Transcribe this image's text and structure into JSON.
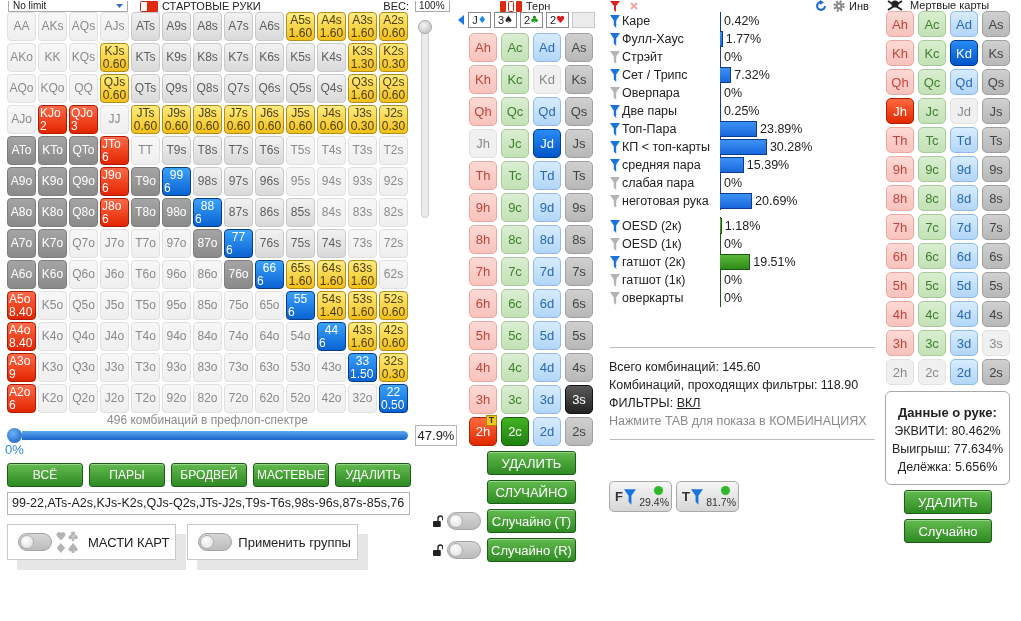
{
  "top_bar": {
    "game_type": "No limit",
    "section_title": "СТАРТОВЫЕ РУКИ",
    "weight_label": "ВЕС:",
    "weight_value": "100%"
  },
  "hand_grid": {
    "rows": [
      [
        {
          "label": "AA",
          "kind": "blocked"
        },
        {
          "label": "AKs",
          "kind": "blocked"
        },
        {
          "label": "AQs",
          "kind": "blocked"
        },
        {
          "label": "AJs",
          "kind": "blocked"
        },
        {
          "label": "ATs",
          "kind": "empty"
        },
        {
          "label": "A9s",
          "kind": "empty"
        },
        {
          "label": "A8s",
          "kind": "empty"
        },
        {
          "label": "A7s",
          "kind": "empty"
        },
        {
          "label": "A6s",
          "kind": "empty"
        },
        {
          "label": "A5s",
          "kind": "yellow",
          "weight": "1.60"
        },
        {
          "label": "A4s",
          "kind": "yellow",
          "weight": "1.60"
        },
        {
          "label": "A3s",
          "kind": "yellow",
          "weight": "1.60"
        },
        {
          "label": "A2s",
          "kind": "yellow",
          "weight": "0.60"
        }
      ],
      [
        {
          "label": "AKo",
          "kind": "blocked"
        },
        {
          "label": "KK",
          "kind": "blocked"
        },
        {
          "label": "KQs",
          "kind": "blocked"
        },
        {
          "label": "KJs",
          "kind": "yellow",
          "weight": "0.60"
        },
        {
          "label": "KTs",
          "kind": "empty"
        },
        {
          "label": "K9s",
          "kind": "empty"
        },
        {
          "label": "K8s",
          "kind": "empty"
        },
        {
          "label": "K7s",
          "kind": "empty"
        },
        {
          "label": "K6s",
          "kind": "empty"
        },
        {
          "label": "K5s",
          "kind": "empty"
        },
        {
          "label": "K4s",
          "kind": "empty"
        },
        {
          "label": "K3s",
          "kind": "yellow",
          "weight": "1.30"
        },
        {
          "label": "K2s",
          "kind": "yellow",
          "weight": "0.30"
        }
      ],
      [
        {
          "label": "AQo",
          "kind": "blocked"
        },
        {
          "label": "KQo",
          "kind": "blocked"
        },
        {
          "label": "QQ",
          "kind": "blocked"
        },
        {
          "label": "QJs",
          "kind": "yellow",
          "weight": "0.60"
        },
        {
          "label": "QTs",
          "kind": "empty"
        },
        {
          "label": "Q9s",
          "kind": "empty"
        },
        {
          "label": "Q8s",
          "kind": "empty"
        },
        {
          "label": "Q7s",
          "kind": "empty"
        },
        {
          "label": "Q6s",
          "kind": "empty"
        },
        {
          "label": "Q5s",
          "kind": "empty"
        },
        {
          "label": "Q4s",
          "kind": "empty"
        },
        {
          "label": "Q3s",
          "kind": "yellow",
          "weight": "1.60"
        },
        {
          "label": "Q2s",
          "kind": "yellow",
          "weight": "0.60"
        }
      ],
      [
        {
          "label": "AJo",
          "kind": "blocked"
        },
        {
          "label": "KJo",
          "kind": "red",
          "weight": "2"
        },
        {
          "label": "QJo",
          "kind": "red",
          "weight": "3"
        },
        {
          "label": "JJ",
          "kind": "blocked"
        },
        {
          "label": "JTs",
          "kind": "yellow",
          "weight": "0.60"
        },
        {
          "label": "J9s",
          "kind": "yellow",
          "weight": "0.60"
        },
        {
          "label": "J8s",
          "kind": "yellow",
          "weight": "0.60"
        },
        {
          "label": "J7s",
          "kind": "yellow",
          "weight": "0.60"
        },
        {
          "label": "J6s",
          "kind": "yellow",
          "weight": "0.60"
        },
        {
          "label": "J5s",
          "kind": "yellow",
          "weight": "0.60"
        },
        {
          "label": "J4s",
          "kind": "yellow",
          "weight": "0.60"
        },
        {
          "label": "J3s",
          "kind": "yellow",
          "weight": "0.30"
        },
        {
          "label": "J2s",
          "kind": "yellow",
          "weight": "0.30"
        }
      ],
      [
        {
          "label": "ATo",
          "kind": "gray"
        },
        {
          "label": "KTo",
          "kind": "gray"
        },
        {
          "label": "QTo",
          "kind": "gray"
        },
        {
          "label": "JTo",
          "kind": "red",
          "weight": "6"
        },
        {
          "label": "TT",
          "kind": "blocked"
        },
        {
          "label": "T9s",
          "kind": "empty"
        },
        {
          "label": "T8s",
          "kind": "empty"
        },
        {
          "label": "T7s",
          "kind": "empty"
        },
        {
          "label": "T6s",
          "kind": "empty"
        },
        {
          "label": "T5s",
          "kind": "blocked"
        },
        {
          "label": "T4s",
          "kind": "blocked"
        },
        {
          "label": "T3s",
          "kind": "blocked"
        },
        {
          "label": "T2s",
          "kind": "blocked"
        }
      ],
      [
        {
          "label": "A9o",
          "kind": "gray"
        },
        {
          "label": "K9o",
          "kind": "gray"
        },
        {
          "label": "Q9o",
          "kind": "gray"
        },
        {
          "label": "J9o",
          "kind": "red",
          "weight": "6"
        },
        {
          "label": "T9o",
          "kind": "gray"
        },
        {
          "label": "99",
          "kind": "blue",
          "weight": "6"
        },
        {
          "label": "98s",
          "kind": "empty"
        },
        {
          "label": "97s",
          "kind": "empty"
        },
        {
          "label": "96s",
          "kind": "empty"
        },
        {
          "label": "95s",
          "kind": "blocked"
        },
        {
          "label": "94s",
          "kind": "blocked"
        },
        {
          "label": "93s",
          "kind": "blocked"
        },
        {
          "label": "92s",
          "kind": "blocked"
        }
      ],
      [
        {
          "label": "A8o",
          "kind": "gray"
        },
        {
          "label": "K8o",
          "kind": "gray"
        },
        {
          "label": "Q8o",
          "kind": "gray"
        },
        {
          "label": "J8o",
          "kind": "red",
          "weight": "6"
        },
        {
          "label": "T8o",
          "kind": "gray"
        },
        {
          "label": "98o",
          "kind": "gray"
        },
        {
          "label": "88",
          "kind": "blue",
          "weight": "6"
        },
        {
          "label": "87s",
          "kind": "empty"
        },
        {
          "label": "86s",
          "kind": "empty"
        },
        {
          "label": "85s",
          "kind": "empty"
        },
        {
          "label": "84s",
          "kind": "blocked"
        },
        {
          "label": "83s",
          "kind": "blocked"
        },
        {
          "label": "82s",
          "kind": "blocked"
        }
      ],
      [
        {
          "label": "A7o",
          "kind": "gray"
        },
        {
          "label": "K7o",
          "kind": "gray"
        },
        {
          "label": "Q7o",
          "kind": "blocked"
        },
        {
          "label": "J7o",
          "kind": "blocked"
        },
        {
          "label": "T7o",
          "kind": "blocked"
        },
        {
          "label": "97o",
          "kind": "blocked"
        },
        {
          "label": "87o",
          "kind": "gray"
        },
        {
          "label": "77",
          "kind": "blue",
          "weight": "6"
        },
        {
          "label": "76s",
          "kind": "empty"
        },
        {
          "label": "75s",
          "kind": "empty"
        },
        {
          "label": "74s",
          "kind": "empty"
        },
        {
          "label": "73s",
          "kind": "blocked"
        },
        {
          "label": "72s",
          "kind": "blocked"
        }
      ],
      [
        {
          "label": "A6o",
          "kind": "gray"
        },
        {
          "label": "K6o",
          "kind": "gray"
        },
        {
          "label": "Q6o",
          "kind": "blocked"
        },
        {
          "label": "J6o",
          "kind": "blocked"
        },
        {
          "label": "T6o",
          "kind": "blocked"
        },
        {
          "label": "96o",
          "kind": "blocked"
        },
        {
          "label": "86o",
          "kind": "blocked"
        },
        {
          "label": "76o",
          "kind": "gray"
        },
        {
          "label": "66",
          "kind": "blue",
          "weight": "6"
        },
        {
          "label": "65s",
          "kind": "yellow",
          "weight": "1.60"
        },
        {
          "label": "64s",
          "kind": "yellow",
          "weight": "1.60"
        },
        {
          "label": "63s",
          "kind": "yellow",
          "weight": "1.60"
        },
        {
          "label": "62s",
          "kind": "blocked"
        }
      ],
      [
        {
          "label": "A5o",
          "kind": "red",
          "weight": "8.40"
        },
        {
          "label": "K5o",
          "kind": "blocked"
        },
        {
          "label": "Q5o",
          "kind": "blocked"
        },
        {
          "label": "J5o",
          "kind": "blocked"
        },
        {
          "label": "T5o",
          "kind": "blocked"
        },
        {
          "label": "95o",
          "kind": "blocked"
        },
        {
          "label": "85o",
          "kind": "blocked"
        },
        {
          "label": "75o",
          "kind": "blocked"
        },
        {
          "label": "65o",
          "kind": "blocked"
        },
        {
          "label": "55",
          "kind": "blue",
          "weight": "6"
        },
        {
          "label": "54s",
          "kind": "yellow",
          "weight": "1.40"
        },
        {
          "label": "53s",
          "kind": "yellow",
          "weight": "1.60"
        },
        {
          "label": "52s",
          "kind": "yellow",
          "weight": "0.60"
        }
      ],
      [
        {
          "label": "A4o",
          "kind": "red",
          "weight": "8.40"
        },
        {
          "label": "K4o",
          "kind": "blocked"
        },
        {
          "label": "Q4o",
          "kind": "blocked"
        },
        {
          "label": "J4o",
          "kind": "blocked"
        },
        {
          "label": "T4o",
          "kind": "blocked"
        },
        {
          "label": "94o",
          "kind": "blocked"
        },
        {
          "label": "84o",
          "kind": "blocked"
        },
        {
          "label": "74o",
          "kind": "blocked"
        },
        {
          "label": "64o",
          "kind": "blocked"
        },
        {
          "label": "54o",
          "kind": "blocked"
        },
        {
          "label": "44",
          "kind": "blue",
          "weight": "6"
        },
        {
          "label": "43s",
          "kind": "yellow",
          "weight": "1.60"
        },
        {
          "label": "42s",
          "kind": "yellow",
          "weight": "0.60"
        }
      ],
      [
        {
          "label": "A3o",
          "kind": "red",
          "weight": "9"
        },
        {
          "label": "K3o",
          "kind": "blocked"
        },
        {
          "label": "Q3o",
          "kind": "blocked"
        },
        {
          "label": "J3o",
          "kind": "blocked"
        },
        {
          "label": "T3o",
          "kind": "blocked"
        },
        {
          "label": "93o",
          "kind": "blocked"
        },
        {
          "label": "83o",
          "kind": "blocked"
        },
        {
          "label": "73o",
          "kind": "blocked"
        },
        {
          "label": "63o",
          "kind": "blocked"
        },
        {
          "label": "53o",
          "kind": "blocked"
        },
        {
          "label": "43o",
          "kind": "blocked"
        },
        {
          "label": "33",
          "kind": "blue",
          "weight": "1.50"
        },
        {
          "label": "32s",
          "kind": "yellow",
          "weight": "0.30"
        }
      ],
      [
        {
          "label": "A2o",
          "kind": "red",
          "weight": "6"
        },
        {
          "label": "K2o",
          "kind": "blocked"
        },
        {
          "label": "Q2o",
          "kind": "blocked"
        },
        {
          "label": "J2o",
          "kind": "blocked"
        },
        {
          "label": "T2o",
          "kind": "blocked"
        },
        {
          "label": "92o",
          "kind": "blocked"
        },
        {
          "label": "82o",
          "kind": "blocked"
        },
        {
          "label": "72o",
          "kind": "blocked"
        },
        {
          "label": "62o",
          "kind": "blocked"
        },
        {
          "label": "52o",
          "kind": "blocked"
        },
        {
          "label": "42o",
          "kind": "blocked"
        },
        {
          "label": "32o",
          "kind": "blocked"
        },
        {
          "label": "22",
          "kind": "blue",
          "weight": "0.50"
        }
      ]
    ]
  },
  "weight_slider": {
    "level": 1
  },
  "range_slider": {
    "caption": "496 комбинаций в префлоп-спектре",
    "level": 0,
    "min_label": "0%",
    "value": "47.9%"
  },
  "range_buttons": [
    "ВСЁ",
    "ПАРЫ",
    "БРОДВЕЙ",
    "МАСТЕВЫЕ",
    "УДАЛИТЬ"
  ],
  "range_text": "99-22,ATs-A2s,KJs-K2s,QJs-Q2s,JTs-J2s,T9s-T6s,98s-96s,87s-85s,76",
  "option_panels": [
    {
      "kind": "suits",
      "label": "МАСТИ КАРТ",
      "on": false
    },
    {
      "kind": "plain",
      "label": "Применить группы",
      "on": false
    }
  ],
  "board": {
    "title": "Терн",
    "cards": [
      {
        "kind": "card",
        "rank": "J",
        "suit": "♦",
        "color": "#1a8cf0"
      },
      {
        "kind": "card",
        "rank": "3",
        "suit": "♠",
        "color": "#222222"
      },
      {
        "kind": "card",
        "rank": "2",
        "suit": "♣",
        "color": "#1e9a1e"
      },
      {
        "kind": "card",
        "rank": "2",
        "suit": "♥",
        "color": "#e01818"
      },
      {
        "kind": "empty"
      }
    ]
  },
  "board_deck": {
    "columns": [
      {
        "kind": "hearts",
        "cards": [
          {
            "label": "Ah",
            "selected": false,
            "disabled": false
          },
          {
            "label": "Kh",
            "selected": false,
            "disabled": false
          },
          {
            "label": "Qh",
            "selected": false,
            "disabled": false
          },
          {
            "label": "Jh",
            "selected": false,
            "disabled": true
          },
          {
            "label": "Th",
            "selected": false,
            "disabled": false
          },
          {
            "label": "9h",
            "selected": false,
            "disabled": false
          },
          {
            "label": "8h",
            "selected": false,
            "disabled": false
          },
          {
            "label": "7h",
            "selected": false,
            "disabled": false
          },
          {
            "label": "6h",
            "selected": false,
            "disabled": false
          },
          {
            "label": "5h",
            "selected": false,
            "disabled": false
          },
          {
            "label": "4h",
            "selected": false,
            "disabled": false
          },
          {
            "label": "3h",
            "selected": false,
            "disabled": false
          },
          {
            "label": "2h",
            "selected": true,
            "disabled": false,
            "badge": "T"
          }
        ]
      },
      {
        "kind": "clubs",
        "cards": [
          {
            "label": "Ac",
            "selected": false,
            "disabled": false
          },
          {
            "label": "Kc",
            "selected": false,
            "disabled": false
          },
          {
            "label": "Qc",
            "selected": false,
            "disabled": false
          },
          {
            "label": "Jc",
            "selected": false,
            "disabled": false
          },
          {
            "label": "Tc",
            "selected": false,
            "disabled": false
          },
          {
            "label": "9c",
            "selected": false,
            "disabled": false
          },
          {
            "label": "8c",
            "selected": false,
            "disabled": false
          },
          {
            "label": "7c",
            "selected": false,
            "disabled": false
          },
          {
            "label": "6c",
            "selected": false,
            "disabled": false
          },
          {
            "label": "5c",
            "selected": false,
            "disabled": false
          },
          {
            "label": "4c",
            "selected": false,
            "disabled": false
          },
          {
            "label": "3c",
            "selected": false,
            "disabled": false
          },
          {
            "label": "2c",
            "selected": true,
            "disabled": false
          }
        ]
      },
      {
        "kind": "diamonds",
        "cards": [
          {
            "label": "Ad",
            "selected": false,
            "disabled": false
          },
          {
            "label": "Kd",
            "selected": false,
            "disabled": true
          },
          {
            "label": "Qd",
            "selected": false,
            "disabled": false
          },
          {
            "label": "Jd",
            "selected": true,
            "disabled": false
          },
          {
            "label": "Td",
            "selected": false,
            "disabled": false
          },
          {
            "label": "9d",
            "selected": false,
            "disabled": false
          },
          {
            "label": "8d",
            "selected": false,
            "disabled": false
          },
          {
            "label": "7d",
            "selected": false,
            "disabled": false
          },
          {
            "label": "6d",
            "selected": false,
            "disabled": false
          },
          {
            "label": "5d",
            "selected": false,
            "disabled": false
          },
          {
            "label": "4d",
            "selected": false,
            "disabled": false
          },
          {
            "label": "3d",
            "selected": false,
            "disabled": false
          },
          {
            "label": "2d",
            "selected": false,
            "disabled": false
          }
        ]
      },
      {
        "kind": "spades",
        "cards": [
          {
            "label": "As",
            "selected": false,
            "disabled": false
          },
          {
            "label": "Ks",
            "selected": false,
            "disabled": false
          },
          {
            "label": "Qs",
            "selected": false,
            "disabled": false
          },
          {
            "label": "Js",
            "selected": false,
            "disabled": false
          },
          {
            "label": "Ts",
            "selected": false,
            "disabled": false
          },
          {
            "label": "9s",
            "selected": false,
            "disabled": false
          },
          {
            "label": "8s",
            "selected": false,
            "disabled": false
          },
          {
            "label": "7s",
            "selected": false,
            "disabled": false
          },
          {
            "label": "6s",
            "selected": false,
            "disabled": false
          },
          {
            "label": "5s",
            "selected": false,
            "disabled": false
          },
          {
            "label": "4s",
            "selected": false,
            "disabled": false
          },
          {
            "label": "3s",
            "selected": true,
            "disabled": false
          },
          {
            "label": "2s",
            "selected": false,
            "disabled": false
          }
        ]
      }
    ]
  },
  "deck_buttons": [
    {
      "kind": "plain",
      "label": "УДАЛИТЬ"
    },
    {
      "kind": "plain",
      "label": "СЛУЧАЙНО"
    },
    {
      "kind": "lockable",
      "label": "Случайно (T)",
      "locked": false,
      "on": false
    },
    {
      "kind": "lockable",
      "label": "Случайно (R)",
      "locked": false,
      "on": false
    }
  ],
  "stats_header": {
    "invert_label": "Инв"
  },
  "stat_groups": [
    {
      "kind": "made",
      "rows": [
        {
          "label": "Каре",
          "value": "0.42%",
          "level": 0.0042,
          "filter_on": true
        },
        {
          "label": "Фулл-Хаус",
          "value": "1.77%",
          "level": 0.0177,
          "filter_on": true
        },
        {
          "label": "Стрэйт",
          "value": "0%",
          "level": 0,
          "filter_on": false
        },
        {
          "label": "Сет / Трипс",
          "value": "7.32%",
          "level": 0.0732,
          "filter_on": true
        },
        {
          "label": "Оверпара",
          "value": "0%",
          "level": 0,
          "filter_on": false
        },
        {
          "label": "Две пары",
          "value": "0.25%",
          "level": 0.0025,
          "filter_on": true
        },
        {
          "label": "Топ-Пара",
          "value": "23.89%",
          "level": 0.2389,
          "filter_on": true
        },
        {
          "label": "КП < топ-карты",
          "value": "30.28%",
          "level": 0.3028,
          "filter_on": true
        },
        {
          "label": "средняя пара",
          "value": "15.39%",
          "level": 0.1539,
          "filter_on": true
        },
        {
          "label": "слабая пара",
          "value": "0%",
          "level": 0,
          "filter_on": false
        },
        {
          "label": "неготовая рука",
          "value": "20.69%",
          "level": 0.2069,
          "filter_on": false
        }
      ]
    },
    {
      "kind": "draws",
      "rows": [
        {
          "label": "OESD (2к)",
          "value": "1.18%",
          "level": 0.0118,
          "filter_on": true
        },
        {
          "label": "OESD (1к)",
          "value": "0%",
          "level": 0,
          "filter_on": false
        },
        {
          "label": "гатшот (2к)",
          "value": "19.51%",
          "level": 0.1951,
          "filter_on": true
        },
        {
          "label": "гатшот (1к)",
          "value": "0%",
          "level": 0,
          "filter_on": false
        },
        {
          "label": "оверкарты",
          "value": "0%",
          "level": 0,
          "filter_on": false
        }
      ]
    }
  ],
  "summary": {
    "total": "Всего комбинаций: 145.60",
    "passing": "Комбинаций, проходящих фильтры: 118.90",
    "filters_label": "ФИЛЬТРЫ:",
    "filters_link": "ВКЛ",
    "hint": "Нажмите TAB для показа в КОМБИНАЦИЯХ"
  },
  "filter_badges": [
    {
      "letter": "F",
      "value": "29.4%",
      "on": true
    },
    {
      "letter": "T",
      "value": "81.7%",
      "on": true
    }
  ],
  "dead_cards": {
    "title": "Мертвые карты",
    "columns": [
      {
        "kind": "hearts",
        "cards": [
          {
            "label": "Ah",
            "selected": false,
            "disabled": false
          },
          {
            "label": "Kh",
            "selected": false,
            "disabled": false
          },
          {
            "label": "Qh",
            "selected": false,
            "disabled": false
          },
          {
            "label": "Jh",
            "selected": true,
            "disabled": false
          },
          {
            "label": "Th",
            "selected": false,
            "disabled": false
          },
          {
            "label": "9h",
            "selected": false,
            "disabled": false
          },
          {
            "label": "8h",
            "selected": false,
            "disabled": false
          },
          {
            "label": "7h",
            "selected": false,
            "disabled": false
          },
          {
            "label": "6h",
            "selected": false,
            "disabled": false
          },
          {
            "label": "5h",
            "selected": false,
            "disabled": false
          },
          {
            "label": "4h",
            "selected": false,
            "disabled": false
          },
          {
            "label": "3h",
            "selected": false,
            "disabled": false
          },
          {
            "label": "2h",
            "selected": false,
            "disabled": true
          }
        ]
      },
      {
        "kind": "clubs",
        "cards": [
          {
            "label": "Ac",
            "selected": false,
            "disabled": false
          },
          {
            "label": "Kc",
            "selected": false,
            "disabled": false
          },
          {
            "label": "Qc",
            "selected": false,
            "disabled": false
          },
          {
            "label": "Jc",
            "selected": false,
            "disabled": false
          },
          {
            "label": "Tc",
            "selected": false,
            "disabled": false
          },
          {
            "label": "9c",
            "selected": false,
            "disabled": false
          },
          {
            "label": "8c",
            "selected": false,
            "disabled": false
          },
          {
            "label": "7c",
            "selected": false,
            "disabled": false
          },
          {
            "label": "6c",
            "selected": false,
            "disabled": false
          },
          {
            "label": "5c",
            "selected": false,
            "disabled": false
          },
          {
            "label": "4c",
            "selected": false,
            "disabled": false
          },
          {
            "label": "3c",
            "selected": false,
            "disabled": false
          },
          {
            "label": "2c",
            "selected": false,
            "disabled": true
          }
        ]
      },
      {
        "kind": "diamonds",
        "cards": [
          {
            "label": "Ad",
            "selected": false,
            "disabled": false
          },
          {
            "label": "Kd",
            "selected": true,
            "disabled": false
          },
          {
            "label": "Qd",
            "selected": false,
            "disabled": false
          },
          {
            "label": "Jd",
            "selected": false,
            "disabled": true
          },
          {
            "label": "Td",
            "selected": false,
            "disabled": false
          },
          {
            "label": "9d",
            "selected": false,
            "disabled": false
          },
          {
            "label": "8d",
            "selected": false,
            "disabled": false
          },
          {
            "label": "7d",
            "selected": false,
            "disabled": false
          },
          {
            "label": "6d",
            "selected": false,
            "disabled": false
          },
          {
            "label": "5d",
            "selected": false,
            "disabled": false
          },
          {
            "label": "4d",
            "selected": false,
            "disabled": false
          },
          {
            "label": "3d",
            "selected": false,
            "disabled": false
          },
          {
            "label": "2d",
            "selected": false,
            "disabled": false
          }
        ]
      },
      {
        "kind": "spades",
        "cards": [
          {
            "label": "As",
            "selected": false,
            "disabled": false
          },
          {
            "label": "Ks",
            "selected": false,
            "disabled": false
          },
          {
            "label": "Qs",
            "selected": false,
            "disabled": false
          },
          {
            "label": "Js",
            "selected": false,
            "disabled": false
          },
          {
            "label": "Ts",
            "selected": false,
            "disabled": false
          },
          {
            "label": "9s",
            "selected": false,
            "disabled": false
          },
          {
            "label": "8s",
            "selected": false,
            "disabled": false
          },
          {
            "label": "7s",
            "selected": false,
            "disabled": false
          },
          {
            "label": "6s",
            "selected": false,
            "disabled": false
          },
          {
            "label": "5s",
            "selected": false,
            "disabled": false
          },
          {
            "label": "4s",
            "selected": false,
            "disabled": false
          },
          {
            "label": "3s",
            "selected": false,
            "disabled": true
          },
          {
            "label": "2s",
            "selected": false,
            "disabled": false
          }
        ]
      }
    ]
  },
  "hand_info": {
    "title": "Данные о руке:",
    "lines": [
      "ЭКВИТИ: 80.462%",
      "Выигрыш: 77.634%",
      "Делёжка: 5.656%"
    ]
  },
  "hand_buttons": [
    "УДАЛИТЬ",
    "Случайно"
  ]
}
